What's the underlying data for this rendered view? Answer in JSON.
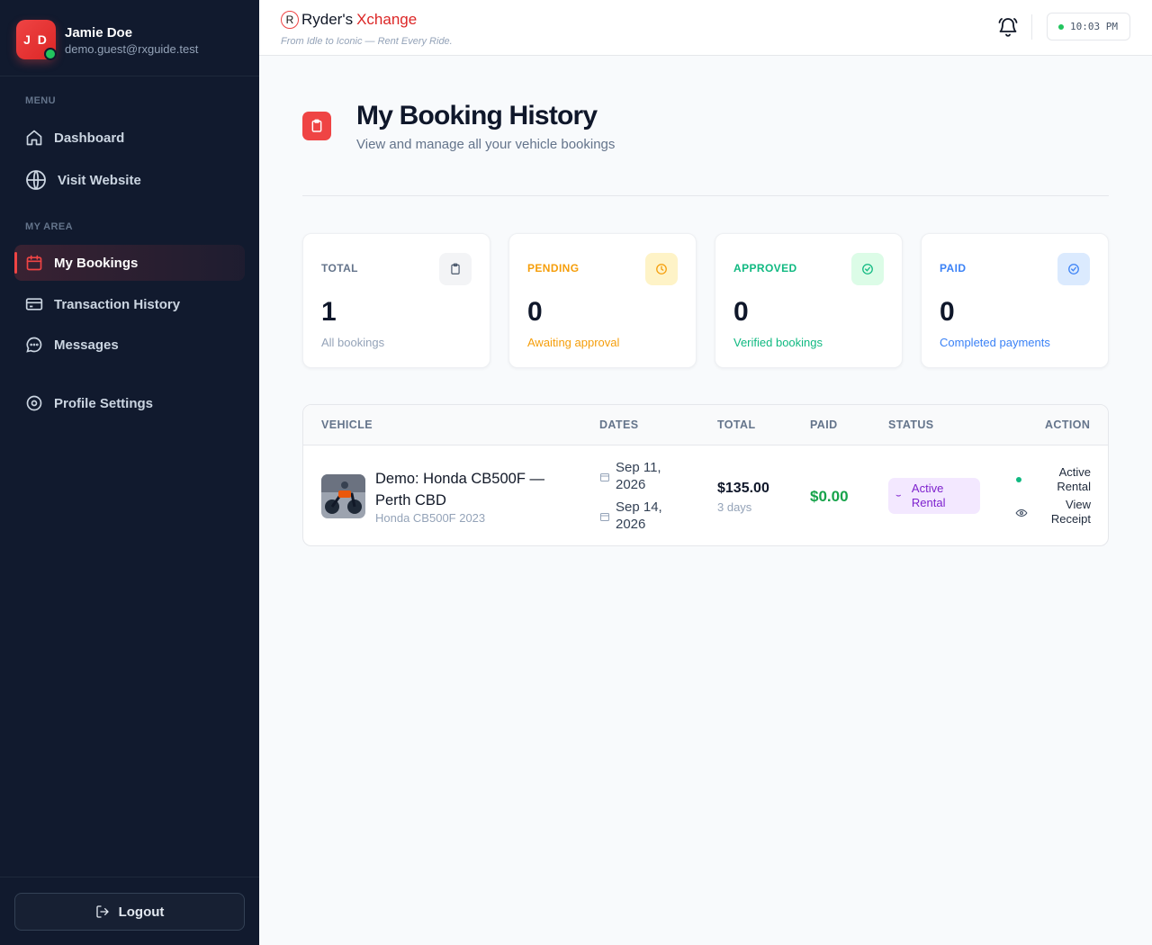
{
  "user": {
    "initials": "J D",
    "name": "Jamie Doe",
    "email": "demo.guest@rxguide.test"
  },
  "sidebar": {
    "menu_label": "MENU",
    "my_area_label": "MY AREA",
    "items": [
      {
        "label": "Dashboard",
        "icon": "home-icon"
      },
      {
        "label": "Visit Website",
        "icon": "globe-icon"
      },
      {
        "label": "My Bookings",
        "icon": "calendar-icon",
        "active": true
      },
      {
        "label": "Transaction History",
        "icon": "credit-card-icon"
      },
      {
        "label": "Messages",
        "icon": "chat-bubble-icon"
      },
      {
        "label": "Profile Settings",
        "icon": "settings-icon"
      }
    ],
    "logout_label": "Logout"
  },
  "header": {
    "logo_mark": "R",
    "logo_part1": "Ryder's",
    "logo_part2": "Xchange",
    "tagline": "From Idle to Iconic — Rent Every Ride.",
    "time": "10:03 PM"
  },
  "page": {
    "title": "My Booking History",
    "subtitle": "View and manage all your vehicle bookings"
  },
  "stats": [
    {
      "label": "TOTAL",
      "value": "1",
      "desc": "All bookings",
      "color": "#64748b",
      "icon": "clipboard-icon"
    },
    {
      "label": "PENDING",
      "value": "0",
      "desc": "Awaiting approval",
      "color": "#f59e0b",
      "icon": "clock-icon"
    },
    {
      "label": "APPROVED",
      "value": "0",
      "desc": "Verified bookings",
      "color": "#10b981",
      "icon": "check-circle-icon"
    },
    {
      "label": "PAID",
      "value": "0",
      "desc": "Completed payments",
      "color": "#3b82f6",
      "icon": "check-circle-icon"
    }
  ],
  "table": {
    "headers": [
      "VEHICLE",
      "DATES",
      "TOTAL",
      "PAID",
      "STATUS",
      "ACTION"
    ],
    "rows": [
      {
        "vehicle_name": "Demo: Honda CB500F — Perth CBD",
        "vehicle_sub": "Honda CB500F 2023",
        "start_date": "Sep 11, 2026",
        "end_date": "Sep 14, 2026",
        "total": "$135.00",
        "duration": "3 days",
        "paid": "$0.00",
        "status": "Active Rental",
        "action_status": "Active Rental",
        "action_receipt": "View Receipt"
      }
    ]
  },
  "colors": {
    "accent": "#ef4444",
    "sidebar_bg": "#111a2e",
    "paid_green": "#16a34a",
    "status_purple": "#7e22ce"
  }
}
